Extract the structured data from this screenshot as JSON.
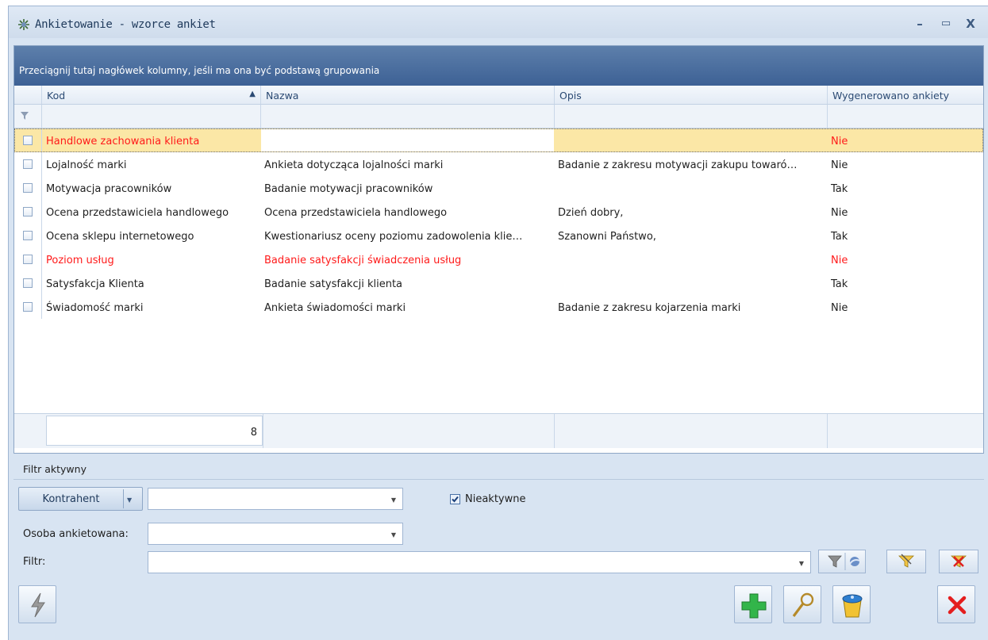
{
  "window": {
    "title": "Ankietowanie - wzorce ankiet",
    "controls": [
      "–",
      "▭",
      "X"
    ]
  },
  "grid": {
    "group_hint": "Przeciągnij tutaj nagłówek kolumny, jeśli ma ona być podstawą grupowania",
    "columns": [
      "Kod",
      "Nazwa",
      "Opis",
      "Wygenerowano ankiety"
    ],
    "sort_indicator": "▲",
    "rows": [
      {
        "kod": "Handlowe zachowania klienta",
        "nazwa": "",
        "opis": "",
        "wygenerowano": "Nie",
        "red": true,
        "selected": true
      },
      {
        "kod": "Lojalność marki",
        "nazwa": "Ankieta dotycząca lojalności marki",
        "opis": "Badanie z zakresu motywacji zakupu towaró…",
        "wygenerowano": "Nie",
        "red": false,
        "selected": false
      },
      {
        "kod": "Motywacja pracowników",
        "nazwa": "Badanie motywacji pracowników",
        "opis": "",
        "wygenerowano": "Tak",
        "red": false,
        "selected": false
      },
      {
        "kod": "Ocena przedstawiciela handlowego",
        "nazwa": "Ocena przedstawiciela handlowego",
        "opis": "Dzień dobry,",
        "wygenerowano": "Nie",
        "red": false,
        "selected": false
      },
      {
        "kod": "Ocena sklepu internetowego",
        "nazwa": "Kwestionariusz oceny poziomu zadowolenia klie…",
        "opis": "Szanowni Państwo,",
        "wygenerowano": "Tak",
        "red": false,
        "selected": false
      },
      {
        "kod": "Poziom usług",
        "nazwa": "Badanie satysfakcji świadczenia usług",
        "opis": "",
        "wygenerowano": "Nie",
        "red": true,
        "selected": false
      },
      {
        "kod": "Satysfakcja Klienta",
        "nazwa": "Badanie satysfakcji klienta",
        "opis": "",
        "wygenerowano": "Tak",
        "red": false,
        "selected": false
      },
      {
        "kod": "Świadomość marki",
        "nazwa": "Ankieta świadomości marki",
        "opis": "Badanie z zakresu kojarzenia marki",
        "wygenerowano": "Nie",
        "red": false,
        "selected": false
      }
    ],
    "footer_count": "8"
  },
  "filter_panel": {
    "title": "Filtr aktywny",
    "kontrahent_label": "Kontrahent",
    "kontrahent_value": "",
    "nieaktywne_label": "Nieaktywne",
    "nieaktywne_checked": true,
    "osoba_label": "Osoba ankietowana:",
    "osoba_value": "",
    "filtr_label": "Filtr:",
    "filtr_value": ""
  },
  "colors": {
    "accent_blue": "#3d6195",
    "selected_row": "#fbe7a6",
    "inactive_text": "#ff1a1a"
  },
  "icons": [
    "app-icon",
    "funnel-icon",
    "apply-filter-icon",
    "clear-filter-icon",
    "lightning-icon",
    "add-icon",
    "magnifier-icon",
    "trash-icon",
    "close-icon"
  ]
}
